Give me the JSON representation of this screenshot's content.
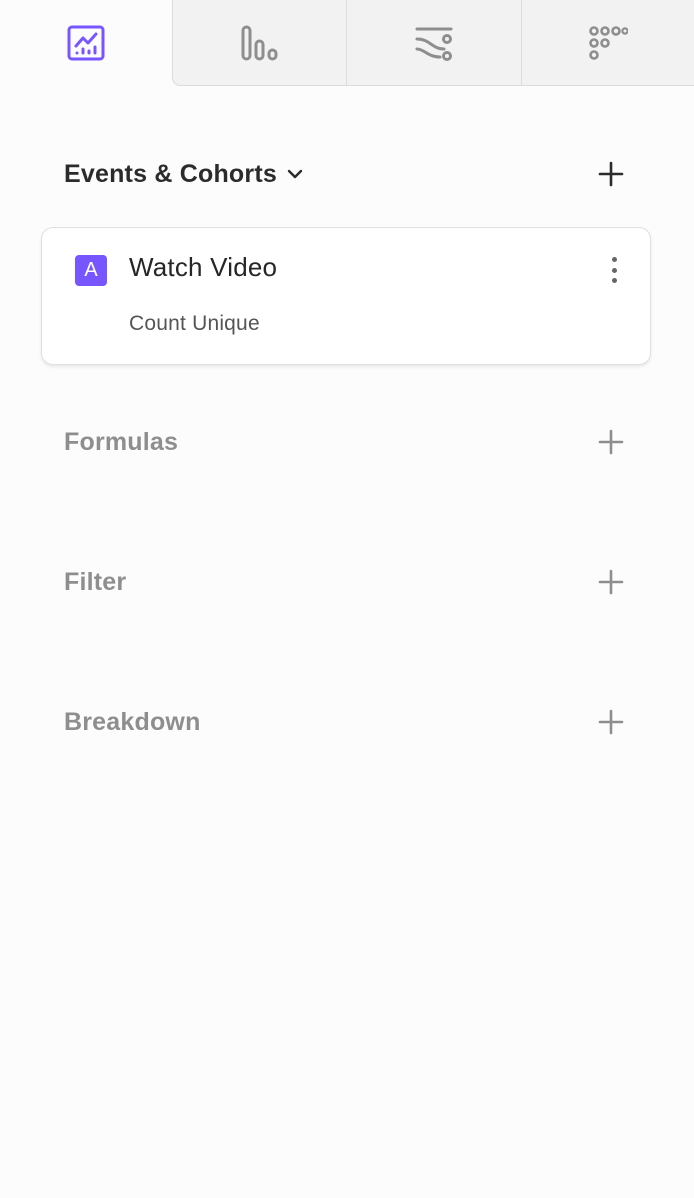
{
  "tabs": [
    {
      "icon": "insights-chart-icon",
      "active": true
    },
    {
      "icon": "bar-chart-icon",
      "active": false
    },
    {
      "icon": "flows-icon",
      "active": false
    },
    {
      "icon": "retention-grid-icon",
      "active": false
    }
  ],
  "sections": {
    "events": {
      "title": "Events & Cohorts",
      "add_icon": "plus-icon",
      "dropdown_icon": "chevron-down-icon"
    },
    "formulas": {
      "title": "Formulas",
      "add_icon": "plus-icon"
    },
    "filter": {
      "title": "Filter",
      "add_icon": "plus-icon"
    },
    "breakdown": {
      "title": "Breakdown",
      "add_icon": "plus-icon"
    }
  },
  "event_card": {
    "badge": "A",
    "name": "Watch Video",
    "measure": "Count Unique",
    "menu_icon": "kebab-menu-icon"
  },
  "colors": {
    "accent": "#7856ff",
    "text_dark": "#2b2b2b",
    "text_muted": "#8e8e8e"
  }
}
